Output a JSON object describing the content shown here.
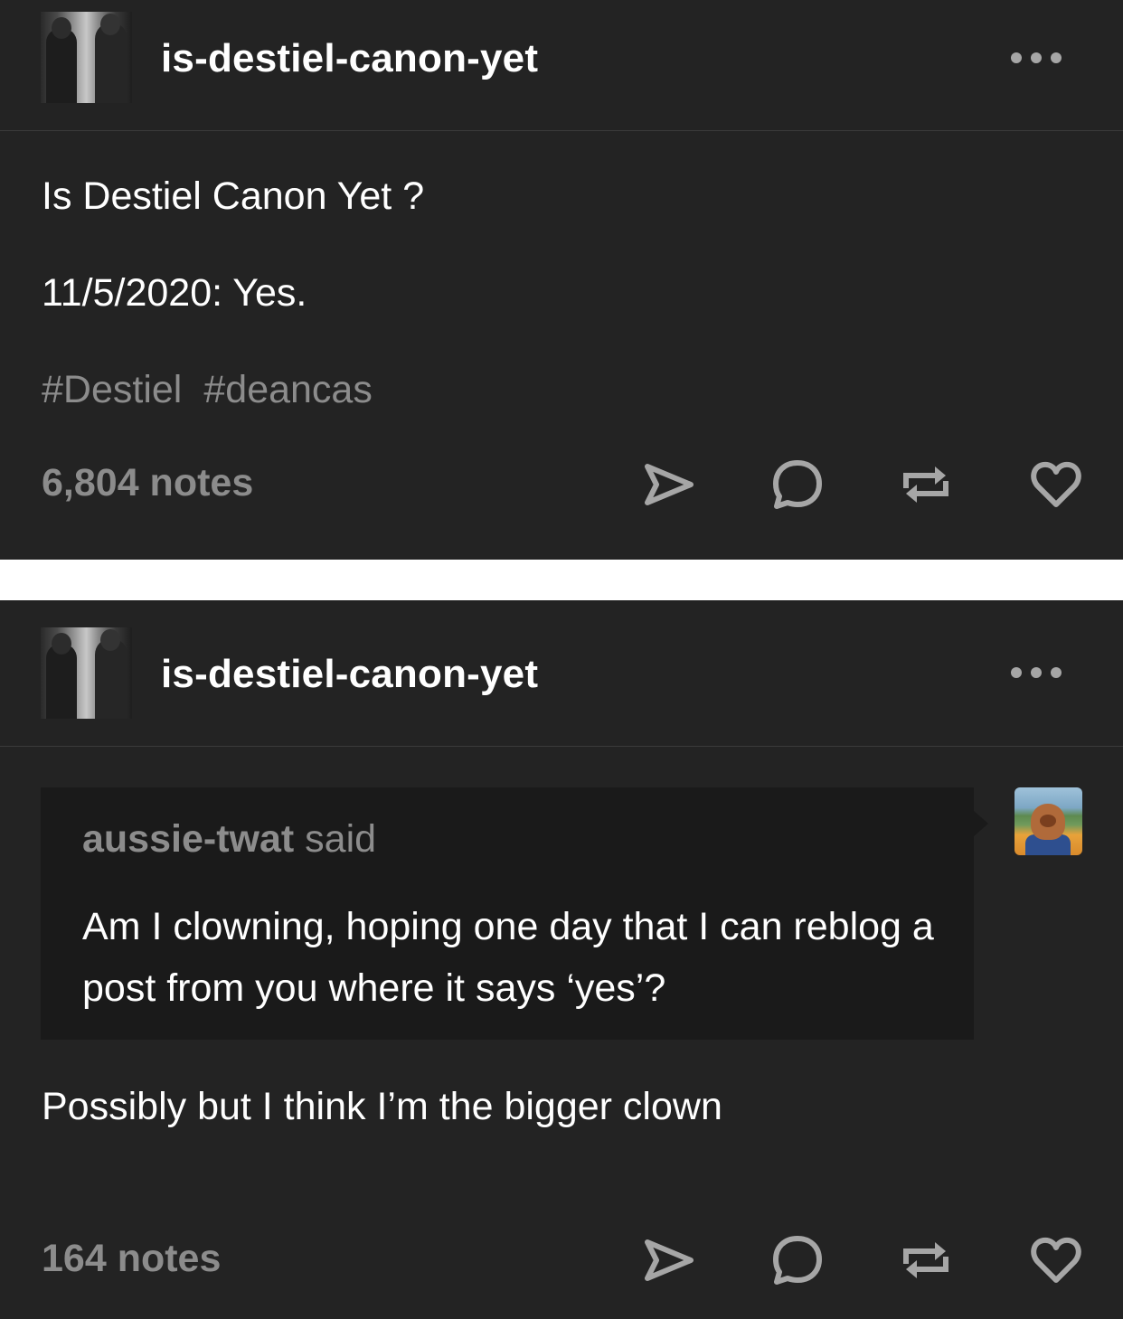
{
  "posts": [
    {
      "blog_name": "is-destiel-canon-yet",
      "body": [
        "Is Destiel Canon Yet ?",
        "11/5/2020: Yes."
      ],
      "tags": [
        "#Destiel",
        "#deancas"
      ],
      "notes": "6,804 notes"
    },
    {
      "blog_name": "is-destiel-canon-yet",
      "quote": {
        "author": "aussie-twat",
        "said": "said",
        "text": "Am I clowning, hoping one day that I can reblog a post from you where it says ‘yes’?"
      },
      "reply": "Possibly but I think I’m the bigger clown",
      "notes": "164 notes"
    }
  ],
  "icons": {
    "share": "send-icon",
    "reply": "comment-icon",
    "reblog": "reblog-icon",
    "like": "heart-icon",
    "more": "more-dots-icon"
  },
  "colors": {
    "post_bg": "#232323",
    "quote_bg": "#1a1a1a",
    "muted_text": "#8c8c8c",
    "icon": "#a6a6a6"
  }
}
